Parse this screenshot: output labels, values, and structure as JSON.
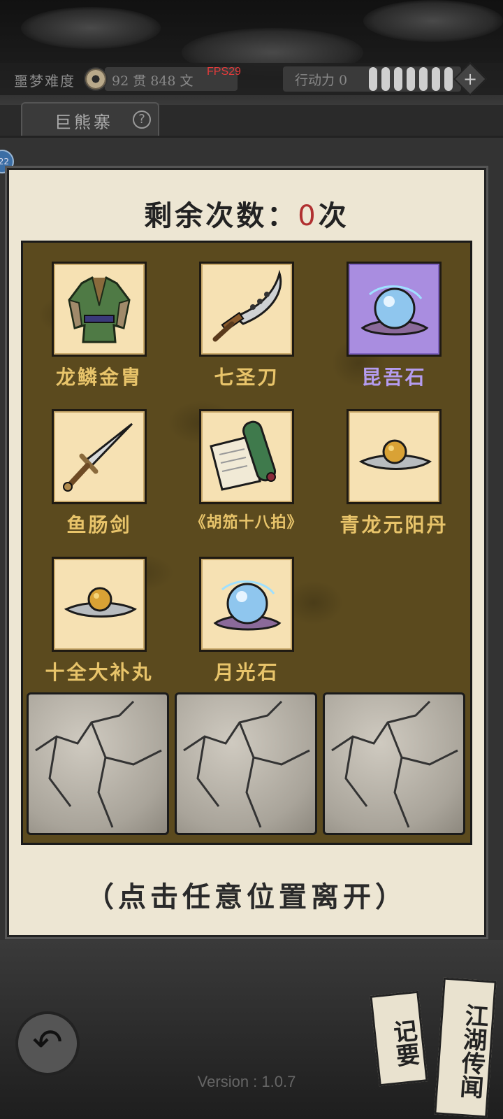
{
  "header": {
    "difficulty_label": "噩梦难度",
    "money_text": "92 贯  848 文",
    "fps": "FPS29",
    "action_points_label": "行动力 0",
    "add_label": "+"
  },
  "location": {
    "name": "巨熊寨",
    "help": "?"
  },
  "side_badge": "22",
  "reward": {
    "remaining_label": "剩余次数：",
    "remaining_count": "0",
    "remaining_unit": "次",
    "items": [
      {
        "name": "龙鳞金胄",
        "icon": "armor-icon",
        "rarity": "gold"
      },
      {
        "name": "七圣刀",
        "icon": "saber-icon",
        "rarity": "gold"
      },
      {
        "name": "昆吾石",
        "icon": "crystal-orb-icon",
        "rarity": "purple"
      },
      {
        "name": "鱼肠剑",
        "icon": "sword-icon",
        "rarity": "gold"
      },
      {
        "name": "《胡笳十八拍》",
        "icon": "scroll-icon",
        "rarity": "gold"
      },
      {
        "name": "青龙元阳丹",
        "icon": "pill-icon",
        "rarity": "gold"
      },
      {
        "name": "十全大补丸",
        "icon": "pill-icon",
        "rarity": "gold"
      },
      {
        "name": "月光石",
        "icon": "crystal-orb-icon",
        "rarity": "gold"
      }
    ],
    "leave_hint": "（点击任意位置离开）"
  },
  "footer": {
    "back_icon": "back-arrow-icon",
    "record_label": "记要",
    "news_label": "江湖传闻",
    "version": "Version : 1.0.7"
  },
  "colors": {
    "panel": "#ede6d3",
    "grid": "#5b4a1e",
    "item_gold_text": "#e8c46a",
    "item_purple_text": "#b59cf0",
    "count_red": "#b03030"
  }
}
